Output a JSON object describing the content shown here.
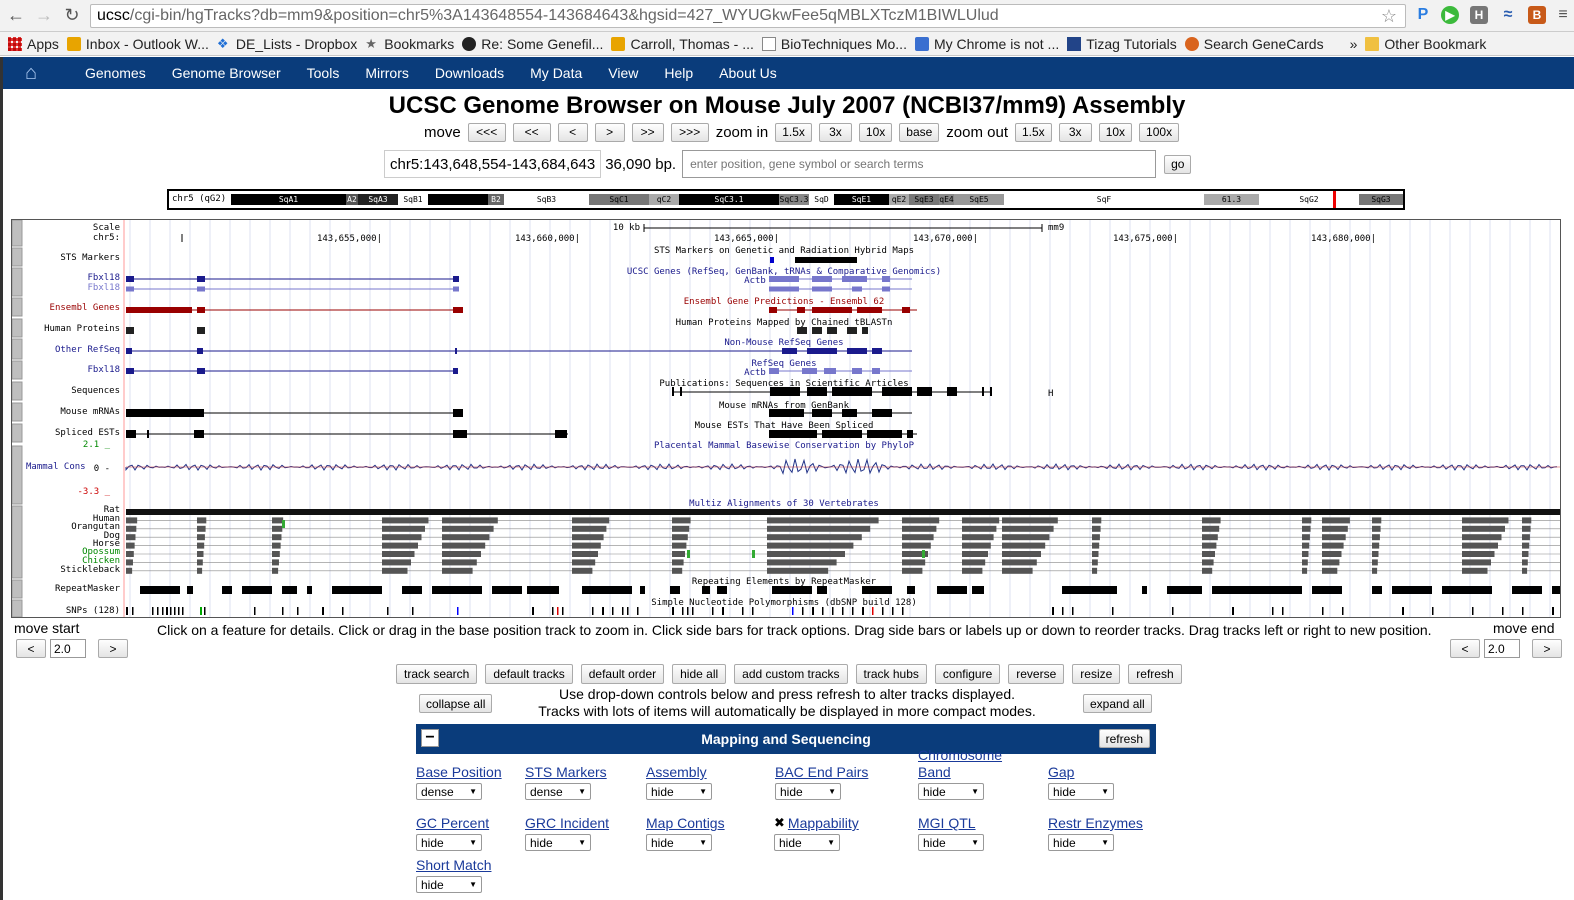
{
  "browser": {
    "url_host": "ucsc",
    "url_path": "/cgi-bin/hgTracks?db=mm9&position=chr5%3A143648554-143684643&hgsid=427_WYUGkwFee5qMBLXTczM1BIWLUlud",
    "bookmarks": [
      "Apps",
      "Inbox - Outlook W...",
      "DE_Lists - Dropbox",
      "Bookmarks",
      "Re: Some Genefil...",
      "Carroll, Thomas - ...",
      "BioTechniques Mo...",
      "My Chrome is not ...",
      "Tizag Tutorials",
      "Search GeneCards",
      "»",
      "Other Bookmark"
    ]
  },
  "nav": {
    "items": [
      "Genomes",
      "Genome Browser",
      "Tools",
      "Mirrors",
      "Downloads",
      "My Data",
      "View",
      "Help",
      "About Us"
    ]
  },
  "page_title": "UCSC Genome Browser on Mouse July 2007 (NCBI37/mm9) Assembly",
  "move": {
    "label": "move",
    "buttons": [
      "<<<",
      "<<",
      "<",
      ">",
      ">>",
      ">>>"
    ],
    "zoom_in_label": "zoom in",
    "zoom_in_buttons": [
      "1.5x",
      "3x",
      "10x",
      "base"
    ],
    "zoom_out_label": "zoom out",
    "zoom_out_buttons": [
      "1.5x",
      "3x",
      "10x",
      "100x"
    ]
  },
  "position": {
    "value": "chr5:143,648,554-143,684,643",
    "bp": "36,090 bp.",
    "search_placeholder": "enter position, gene symbol or search terms",
    "go": "go"
  },
  "ideogram": {
    "chrom_label": "chr5 (qG2)",
    "bands": [
      "SqA1",
      "A2",
      "SqA3",
      "SqB1",
      "B2",
      "SqB3",
      "SqC1",
      "qC2",
      "SqC3.1",
      "SqC3.3",
      "SqD",
      "SqE1",
      "qE2",
      "SqE3",
      "qE4",
      "SqE5",
      "SqF",
      "61.3",
      "SqG2",
      "SqG3"
    ]
  },
  "tracks": {
    "scale_label": "Scale",
    "chr_label": "chr5:",
    "scale_text": "10 kb",
    "assembly_tag": "mm9",
    "coords": [
      "143,655,000|",
      "143,660,000|",
      "143,665,000|",
      "143,670,000|",
      "143,675,000|",
      "143,680,000|"
    ],
    "left_labels": [
      "STS Markers",
      "Fbxl18",
      "Fbxl18",
      "Ensembl Genes",
      "Human Proteins",
      "Other RefSeq",
      "Fbxl18",
      "Sequences",
      "Mouse mRNAs",
      "Spliced ESTs",
      "2.1 _",
      "Mammal Cons",
      "0 -",
      "-3.3 _",
      "Rat",
      "Human",
      "Orangutan",
      "Dog",
      "Horse",
      "Opossum",
      "Chicken",
      "Stickleback",
      "RepeatMasker",
      "SNPs (128)"
    ],
    "center_titles": [
      "STS Markers on Genetic and Radiation Hybrid Maps",
      "UCSC Genes (RefSeq, GenBank, tRNAs & Comparative Genomics)",
      "Actb",
      "Ensembl Gene Predictions - Ensembl 62",
      "Human Proteins Mapped by Chained tBLASTn",
      "Non-Mouse RefSeq Genes",
      "RefSeq Genes",
      "Actb",
      "Publications: Sequences in Scientific Articles",
      "Mouse mRNAs from GenBank",
      "Mouse ESTs That Have Been Spliced",
      "Placental Mammal Basewise Conservation by PhyloP",
      "Multiz Alignments of 30 Vertebrates",
      "Repeating Elements by RepeatMasker",
      "Simple Nucleotide Polymorphisms (dbSNP build 128)"
    ],
    "h_mark": "H"
  },
  "move_start": {
    "label": "move start",
    "left": "<",
    "value": "2.0",
    "right": ">"
  },
  "move_end": {
    "label": "move end",
    "left": "<",
    "value": "2.0",
    "right": ">"
  },
  "help_text": "Click on a feature for details. Click or drag in the base position track to zoom in. Click side bars for track options. Drag side bars or labels up or down to reorder tracks. Drag tracks left or right to new position.",
  "track_buttons": [
    "track search",
    "default tracks",
    "default order",
    "hide all",
    "add custom tracks",
    "track hubs",
    "configure",
    "reverse",
    "resize",
    "refresh"
  ],
  "collapse_all": "collapse all",
  "expand_all": "expand all",
  "dropdown_note_1": "Use drop-down controls below and press refresh to alter tracks displayed.",
  "dropdown_note_2": "Tracks with lots of items will automatically be displayed in more compact modes.",
  "mapping_section": {
    "collapse": "−",
    "title": "Mapping and Sequencing",
    "refresh": "refresh",
    "tracks": [
      {
        "name": "Base Position",
        "mode": "dense"
      },
      {
        "name": "STS Markers",
        "mode": "dense"
      },
      {
        "name": "Assembly",
        "mode": "hide"
      },
      {
        "name": "BAC End Pairs",
        "mode": "hide"
      },
      {
        "name": "Chromosome Band",
        "mode": "hide"
      },
      {
        "name": "Gap",
        "mode": "hide"
      },
      {
        "name": "GC Percent",
        "mode": "hide"
      },
      {
        "name": "GRC Incident",
        "mode": "hide"
      },
      {
        "name": "Map Contigs",
        "mode": "hide"
      },
      {
        "name": "Mappability",
        "mode": "hide"
      },
      {
        "name": "MGI QTL",
        "mode": "hide"
      },
      {
        "name": "Restr Enzymes",
        "mode": "hide"
      },
      {
        "name": "Short Match",
        "mode": "hide"
      }
    ]
  },
  "colors": {
    "nav_bg": "#0a3c7b",
    "link": "#1a3a9a",
    "ensembl": "#990000",
    "ucsc_gene": "#1a1a8c",
    "refseq_light": "#7777cc"
  }
}
